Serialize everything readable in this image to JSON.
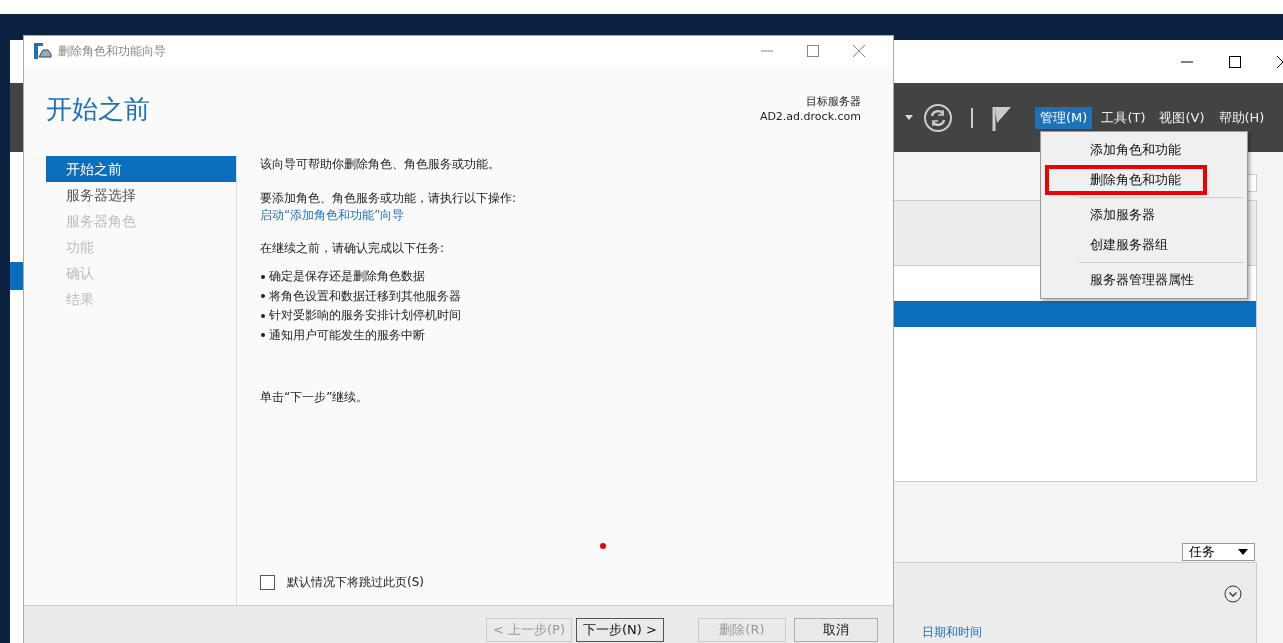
{
  "background_window": {
    "menu_bar": [
      {
        "label": "管理(M)",
        "selected": true
      },
      {
        "label": "工具(T)",
        "selected": false
      },
      {
        "label": "视图(V)",
        "selected": false
      },
      {
        "label": "帮助(H)",
        "selected": false
      }
    ],
    "dropdown_menu": [
      {
        "label": "添加角色和功能",
        "highlighted": false,
        "separator_after": false
      },
      {
        "label": "删除角色和功能",
        "highlighted": true,
        "separator_after": true
      },
      {
        "label": "添加服务器",
        "highlighted": false,
        "separator_after": false
      },
      {
        "label": "创建服务器组",
        "highlighted": false,
        "separator_after": true
      },
      {
        "label": "服务器管理器属性",
        "highlighted": false,
        "separator_after": false
      }
    ],
    "tasks_button": "任务",
    "column_header": "日期和时间"
  },
  "dialog": {
    "title": "删除角色和功能向导",
    "heading": "开始之前",
    "target_label": "目标服务器",
    "target_server": "AD2.ad.drock.com",
    "steps": [
      {
        "label": "开始之前",
        "selected": true,
        "disabled": false
      },
      {
        "label": "服务器选择",
        "selected": false,
        "disabled": false
      },
      {
        "label": "服务器角色",
        "selected": false,
        "disabled": true
      },
      {
        "label": "功能",
        "selected": false,
        "disabled": true
      },
      {
        "label": "确认",
        "selected": false,
        "disabled": true
      },
      {
        "label": "结果",
        "selected": false,
        "disabled": true
      }
    ],
    "intro": "该向导可帮助你删除角色、角色服务或功能。",
    "add_hint": "要添加角色、角色服务或功能，请执行以下操作:",
    "add_link": "启动“添加角色和功能”向导",
    "tasks_intro": "在继续之前，请确认完成以下任务:",
    "tasks": [
      "确定是保存还是删除角色数据",
      "将角色设置和数据迁移到其他服务器",
      "针对受影响的服务安排计划停机时间",
      "通知用户可能发生的服务中断"
    ],
    "continue_hint": "单击“下一步”继续。",
    "skip_checkbox": {
      "label": "默认情况下将跳过此页(S)",
      "checked": false
    },
    "buttons": [
      {
        "label": "< 上一步(P)",
        "disabled": true,
        "default": false
      },
      {
        "label": "下一步(N) >",
        "disabled": false,
        "default": true
      },
      {
        "label": "删除(R)",
        "disabled": true,
        "default": false
      },
      {
        "label": "取消",
        "disabled": false,
        "default": false
      }
    ]
  }
}
